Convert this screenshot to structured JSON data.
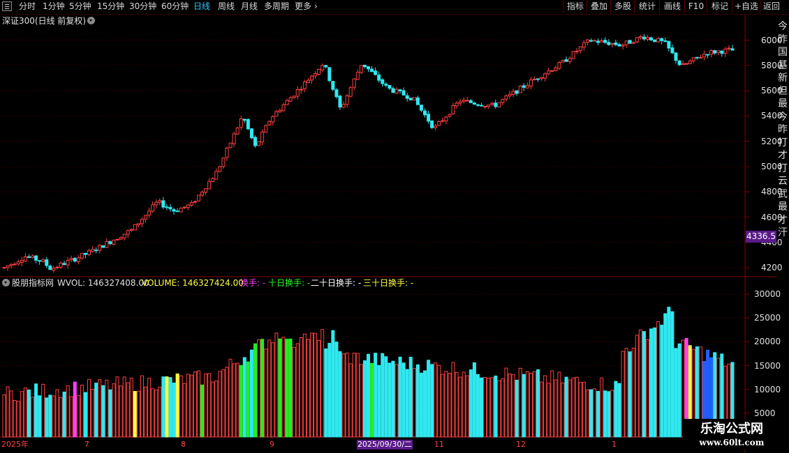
{
  "toolbar": {
    "periods": [
      {
        "label": "分时",
        "active": false
      },
      {
        "label": "1分钟",
        "active": false
      },
      {
        "label": "5分钟",
        "active": false
      },
      {
        "label": "15分钟",
        "active": false
      },
      {
        "label": "30分钟",
        "active": false
      },
      {
        "label": "60分钟",
        "active": false
      },
      {
        "label": "日线",
        "active": true
      },
      {
        "label": "周线",
        "active": false
      },
      {
        "label": "月线",
        "active": false
      },
      {
        "label": "多周期",
        "active": false
      },
      {
        "label": "更多",
        "active": false
      }
    ],
    "right_buttons": [
      "指标",
      "叠加",
      "多股",
      "统计",
      "画线",
      "F10",
      "标记",
      "+自选",
      "返回"
    ]
  },
  "price_panel": {
    "title": "深证300(日线 前复权)",
    "y_ticks": [
      "6000",
      "5800",
      "5600",
      "5400",
      "5200",
      "5000",
      "4800",
      "4600",
      "4400",
      "4200"
    ],
    "crosshair_price": "4336.5"
  },
  "volume_panel": {
    "indicator_name": "股朋指标网",
    "wvol_label": "WVOL: 146327408.00",
    "volume_label": "VOLUME: 146327424.00",
    "turnover_labels": [
      {
        "text": "换手: -",
        "color": "#ff3cff"
      },
      {
        "text": "十日换手: -",
        "color": "#22ff22"
      },
      {
        "text": "二十日换手: -",
        "color": "#ffffff"
      },
      {
        "text": "三十日换手: -",
        "color": "#ffff40"
      }
    ],
    "y_ticks": [
      "30000",
      "25000",
      "20000",
      "15000",
      "10000",
      "5000"
    ]
  },
  "x_axis": {
    "labels": [
      "2025年",
      "7",
      "8",
      "9",
      "11",
      "12",
      "1"
    ],
    "cursor_date": "2025/09/30/二"
  },
  "right_strip_chars": [
    "今",
    "昨",
    "国",
    "基",
    "新",
    "但",
    "最",
    "今",
    "昨",
    "打",
    "才",
    "打",
    "云",
    "武",
    "最",
    "才",
    "汗"
  ],
  "watermark": {
    "line1": "乐淘公式网",
    "line2": "www.60lt.com"
  },
  "colors": {
    "up": "#ff4040",
    "down": "#30e8f0",
    "ten_day": "#22ee22",
    "yellow": "#ffff40",
    "magenta": "#ff40ff",
    "blue": "#2060ff"
  },
  "chart_data": {
    "type": "candlestick",
    "y_range": [
      4140,
      6080
    ],
    "volume_range": [
      0,
      31500
    ],
    "x_axis_labels": [
      "2025年",
      "7",
      "8",
      "9",
      "11",
      "12",
      "1"
    ],
    "candles": [],
    "volumes": []
  }
}
